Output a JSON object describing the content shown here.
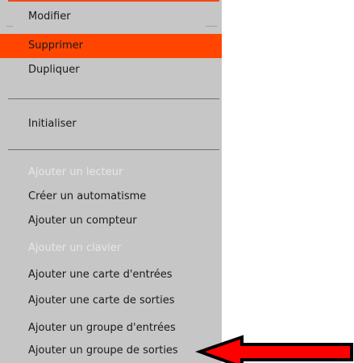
{
  "menu": {
    "items": [
      {
        "label": "Modifier",
        "state": "normal"
      },
      {
        "label": "Supprimer",
        "state": "highlighted"
      },
      {
        "label": "Dupliquer",
        "state": "normal"
      },
      {
        "label": "Initialiser",
        "state": "normal"
      },
      {
        "label": "Ajouter un lecteur",
        "state": "disabled"
      },
      {
        "label": "Créer un automatisme",
        "state": "normal"
      },
      {
        "label": "Ajouter un compteur",
        "state": "normal"
      },
      {
        "label": "Ajouter un clavier",
        "state": "disabled"
      },
      {
        "label": "Ajouter une carte d'entrées",
        "state": "normal"
      },
      {
        "label": "Ajouter une carte de sorties",
        "state": "normal"
      },
      {
        "label": "Ajouter un groupe d'entrées",
        "state": "normal"
      },
      {
        "label": "Ajouter un groupe de sorties",
        "state": "normal"
      }
    ]
  },
  "annotation": {
    "arrow_color": "#ff0000",
    "arrow_outline": "#000000",
    "points_to": "Ajouter un groupe de sorties"
  },
  "colors": {
    "menu_background": "#c6c6c6",
    "highlight": "#ff4500",
    "disabled_text": "#e6e6e6",
    "text": "#1a1a1a"
  }
}
